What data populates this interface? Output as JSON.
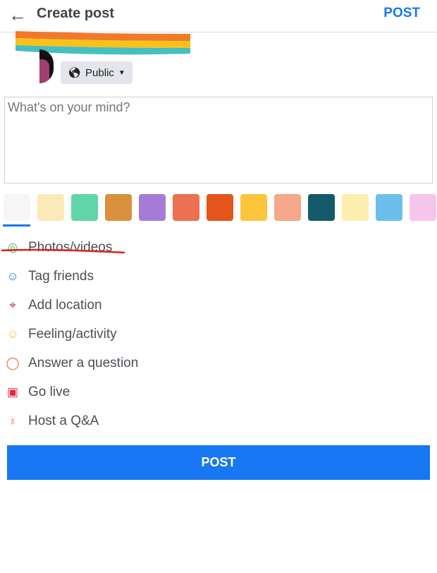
{
  "header": {
    "title": "Create post",
    "post_label": "POST",
    "back_icon": "arrow-left-icon"
  },
  "audience": {
    "label": "Public",
    "icon": "globe-icon"
  },
  "composer": {
    "placeholder": "What's on your mind?"
  },
  "backgrounds": [
    "#f5f6f7",
    "#fbe9b9",
    "#5fd5a8",
    "#d9913e",
    "#a67bd8",
    "#ec7052",
    "#e4541b",
    "#fcc53b",
    "#f6a88a",
    "#145a6a",
    "#fdeeb0",
    "#6bbfea",
    "#f6c6ea"
  ],
  "actions": [
    {
      "label": "Photos/videos",
      "icon": "camera-icon",
      "color": "#45bd62"
    },
    {
      "label": "Tag friends",
      "icon": "tag-person-icon",
      "color": "#1877f2"
    },
    {
      "label": "Add location",
      "icon": "location-pin-icon",
      "color": "#c0327a"
    },
    {
      "label": "Feeling/activity",
      "icon": "smiley-icon",
      "color": "#f7b928"
    },
    {
      "label": "Answer a question",
      "icon": "speech-bubble-icon",
      "color": "#e8683a"
    },
    {
      "label": "Go live",
      "icon": "video-camera-icon",
      "color": "#e42645"
    },
    {
      "label": "Host a Q&A",
      "icon": "microphone-icon",
      "color": "#e8683a"
    }
  ],
  "footer": {
    "post_label": "POST"
  },
  "accent": "#1877f2"
}
